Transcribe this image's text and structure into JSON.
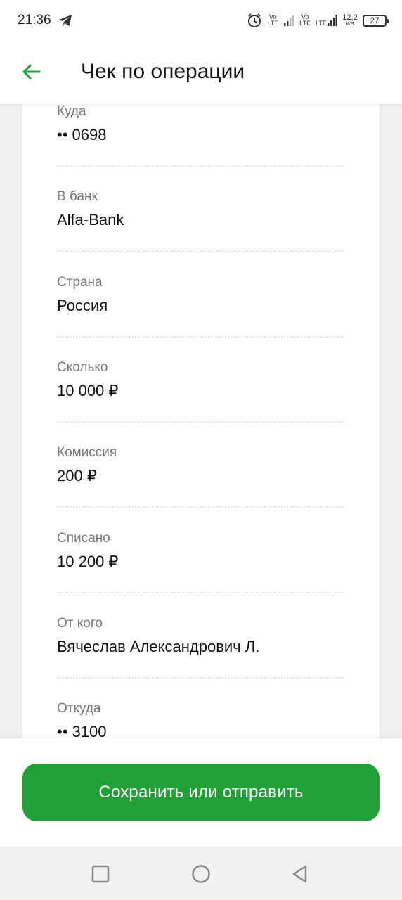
{
  "status_bar": {
    "time": "21:36",
    "icons": [
      "telegram-icon",
      "alarm-icon",
      "volte-icon",
      "signal-icon",
      "lte-signal-icon",
      "net-speed-icon",
      "battery-icon"
    ],
    "vo_lte_1": "Vo\nLTE",
    "vo_lte_2": "Vo\nLTE",
    "lte": "LTE",
    "net_speed_value": "12,2",
    "net_speed_unit": "K/S",
    "battery": "27"
  },
  "header": {
    "title": "Чек по операции",
    "back_icon": "arrow-left-icon"
  },
  "receipt": {
    "fields": [
      {
        "label": "Куда",
        "value": "•• 0698"
      },
      {
        "label": "В банк",
        "value": "Alfa-Bank"
      },
      {
        "label": "Страна",
        "value": "Россия"
      },
      {
        "label": "Сколько",
        "value": "10 000 ₽"
      },
      {
        "label": "Комиссия",
        "value": "200 ₽"
      },
      {
        "label": "Списано",
        "value": "10 200 ₽"
      },
      {
        "label": "От кого",
        "value": "Вячеслав Александрович Л."
      },
      {
        "label": "Откуда",
        "value": "•• 3100"
      }
    ]
  },
  "actions": {
    "save_label": "Сохранить или отправить"
  },
  "nav": {
    "icons": [
      "recents-square-icon",
      "home-circle-icon",
      "back-triangle-icon"
    ]
  },
  "colors": {
    "accent": "#21a038",
    "label": "#777777",
    "text": "#111111"
  }
}
